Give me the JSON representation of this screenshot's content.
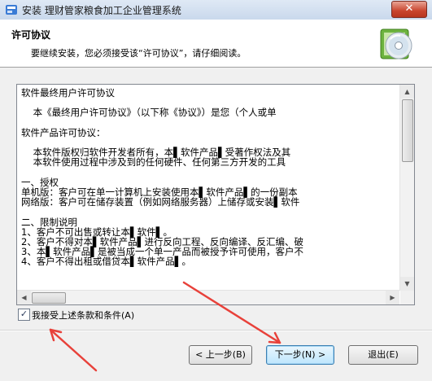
{
  "window": {
    "title": "安装 理财管家粮食加工企业管理系统",
    "close_glyph": "✕"
  },
  "header": {
    "title": "许可协议",
    "subtitle": "要继续安装，您必须接受该“许可协议”，请仔细阅读。",
    "icon": "cd-disc-icon"
  },
  "license": {
    "lines": [
      "软件最终用户许可协议",
      "",
      "    本《最终用户许可协议》（以下称《协议》）是您（个人或单",
      "",
      "软件产品许可协议：",
      "",
      "    本软件版权归软件开发者所有，本▌软件产品▌受著作权法及其",
      "    本软件使用过程中涉及到的任何硬件、任何第三方开发的工具",
      "",
      "一、授权",
      "单机版：客户可在单一计算机上安装使用本▌软件产品▌的一份副本",
      "网络版：客户可在储存装置（例如网络服务器）上储存或安装▌软件",
      "",
      "二、限制说明",
      "1、客户不可出售或转让本▌软件▌。",
      "2、客户不得对本▌软件产品▌进行反向工程、反向编译、反汇编、破",
      "3、本▌软件产品▌是被当成一个单一产品而被授予许可使用，客户不",
      "4、客户不得出租或借贷本▌软件产品▌。"
    ]
  },
  "accept": {
    "checked": true,
    "check_glyph": "✓",
    "label": "我接受上述条款和条件(A)"
  },
  "buttons": {
    "back": "< 上一步(B)",
    "next": "下一步(N) >",
    "exit": "退出(E)"
  },
  "colors": {
    "arrow": "#e8413a",
    "close_button": "#c9452e"
  }
}
